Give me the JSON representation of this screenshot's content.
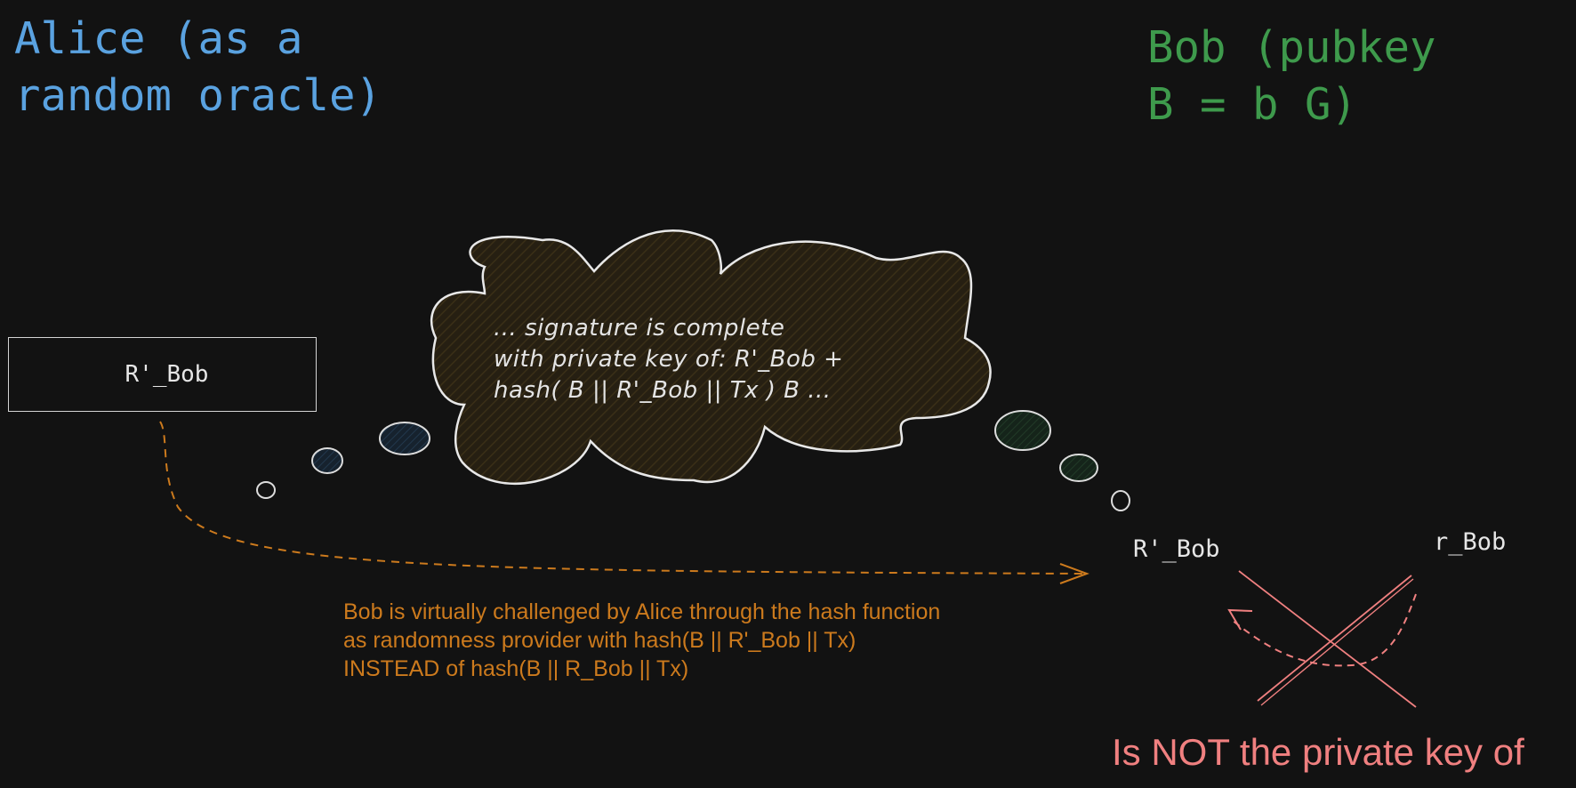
{
  "alice": {
    "line1": "Alice (as a",
    "line2": "random oracle)"
  },
  "bob": {
    "line1": "Bob (pubkey",
    "line2": "B = b G)"
  },
  "box": {
    "label": "R'_Bob"
  },
  "thought": {
    "line1": "... signature is complete",
    "line2": "with private key of: R'_Bob +",
    "line3": "hash( B || R'_Bob || Tx ) B ..."
  },
  "labels": {
    "r_prime_bob": "R'_Bob",
    "r_bob": "r_Bob"
  },
  "note": {
    "line1": "Bob is virtually challenged by Alice through the hash function",
    "line2": "as randomness provider with hash(B || R'_Bob || Tx)",
    "line3": "INSTEAD of hash(B || R_Bob || Tx)"
  },
  "warning": "Is NOT the private key of",
  "colors": {
    "alice": "#5aa2e0",
    "bob": "#3e9a4c",
    "arrow": "#cc7a1d",
    "cross": "#f08080",
    "cloud_fill": "#2b2212"
  }
}
